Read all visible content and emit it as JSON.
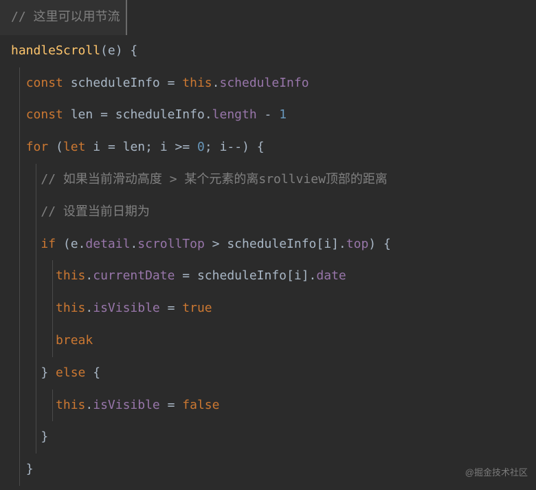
{
  "code": {
    "lines": [
      {
        "indent": 0,
        "tokens": [
          {
            "t": "// 这里可以用节流",
            "c": "comment"
          }
        ],
        "highlight": true
      },
      {
        "indent": 0,
        "tokens": [
          {
            "t": "handleScroll",
            "c": "method"
          },
          {
            "t": "(",
            "c": "punct"
          },
          {
            "t": "e",
            "c": "param"
          },
          {
            "t": ") {",
            "c": "punct"
          }
        ]
      },
      {
        "indent": 1,
        "tokens": [
          {
            "t": "const ",
            "c": "keyword"
          },
          {
            "t": "scheduleInfo ",
            "c": "var"
          },
          {
            "t": "= ",
            "c": "op"
          },
          {
            "t": "this",
            "c": "this"
          },
          {
            "t": ".",
            "c": "punct"
          },
          {
            "t": "scheduleInfo",
            "c": "prop"
          }
        ]
      },
      {
        "indent": 1,
        "tokens": [
          {
            "t": "const ",
            "c": "keyword"
          },
          {
            "t": "len ",
            "c": "var"
          },
          {
            "t": "= ",
            "c": "op"
          },
          {
            "t": "scheduleInfo",
            "c": "var"
          },
          {
            "t": ".",
            "c": "punct"
          },
          {
            "t": "length ",
            "c": "prop"
          },
          {
            "t": "- ",
            "c": "op"
          },
          {
            "t": "1",
            "c": "num"
          }
        ]
      },
      {
        "indent": 1,
        "tokens": [
          {
            "t": "for ",
            "c": "keyword"
          },
          {
            "t": "(",
            "c": "punct"
          },
          {
            "t": "let ",
            "c": "keyword"
          },
          {
            "t": "i ",
            "c": "var"
          },
          {
            "t": "= ",
            "c": "op"
          },
          {
            "t": "len",
            "c": "var"
          },
          {
            "t": "; ",
            "c": "punct"
          },
          {
            "t": "i ",
            "c": "var"
          },
          {
            "t": ">= ",
            "c": "op"
          },
          {
            "t": "0",
            "c": "num"
          },
          {
            "t": "; ",
            "c": "punct"
          },
          {
            "t": "i",
            "c": "var"
          },
          {
            "t": "--",
            "c": "op"
          },
          {
            "t": ") {",
            "c": "punct"
          }
        ]
      },
      {
        "indent": 2,
        "tokens": [
          {
            "t": "// 如果当前滑动高度 > 某个元素的离srollview顶部的距离",
            "c": "comment"
          }
        ]
      },
      {
        "indent": 2,
        "tokens": [
          {
            "t": "// 设置当前日期为",
            "c": "comment"
          }
        ]
      },
      {
        "indent": 2,
        "tokens": [
          {
            "t": "if ",
            "c": "keyword"
          },
          {
            "t": "(",
            "c": "punct"
          },
          {
            "t": "e",
            "c": "var"
          },
          {
            "t": ".",
            "c": "punct"
          },
          {
            "t": "detail",
            "c": "prop"
          },
          {
            "t": ".",
            "c": "punct"
          },
          {
            "t": "scrollTop ",
            "c": "prop"
          },
          {
            "t": "> ",
            "c": "op"
          },
          {
            "t": "scheduleInfo",
            "c": "var"
          },
          {
            "t": "[",
            "c": "punct"
          },
          {
            "t": "i",
            "c": "var"
          },
          {
            "t": "]",
            "c": "punct"
          },
          {
            "t": ".",
            "c": "punct"
          },
          {
            "t": "top",
            "c": "prop"
          },
          {
            "t": ") {",
            "c": "punct"
          }
        ]
      },
      {
        "indent": 3,
        "tokens": [
          {
            "t": "this",
            "c": "this"
          },
          {
            "t": ".",
            "c": "punct"
          },
          {
            "t": "currentDate ",
            "c": "prop"
          },
          {
            "t": "= ",
            "c": "op"
          },
          {
            "t": "scheduleInfo",
            "c": "var"
          },
          {
            "t": "[",
            "c": "punct"
          },
          {
            "t": "i",
            "c": "var"
          },
          {
            "t": "]",
            "c": "punct"
          },
          {
            "t": ".",
            "c": "punct"
          },
          {
            "t": "date",
            "c": "prop"
          }
        ]
      },
      {
        "indent": 3,
        "tokens": [
          {
            "t": "this",
            "c": "this"
          },
          {
            "t": ".",
            "c": "punct"
          },
          {
            "t": "isVisible ",
            "c": "prop"
          },
          {
            "t": "= ",
            "c": "op"
          },
          {
            "t": "true",
            "c": "bool"
          }
        ]
      },
      {
        "indent": 3,
        "tokens": [
          {
            "t": "break",
            "c": "keyword"
          }
        ]
      },
      {
        "indent": 2,
        "tokens": [
          {
            "t": "} ",
            "c": "punct"
          },
          {
            "t": "else ",
            "c": "keyword"
          },
          {
            "t": "{",
            "c": "punct"
          }
        ]
      },
      {
        "indent": 3,
        "tokens": [
          {
            "t": "this",
            "c": "this"
          },
          {
            "t": ".",
            "c": "punct"
          },
          {
            "t": "isVisible ",
            "c": "prop"
          },
          {
            "t": "= ",
            "c": "op"
          },
          {
            "t": "false",
            "c": "bool"
          }
        ]
      },
      {
        "indent": 2,
        "tokens": [
          {
            "t": "}",
            "c": "punct"
          }
        ]
      },
      {
        "indent": 1,
        "tokens": [
          {
            "t": "}",
            "c": "punct"
          }
        ]
      }
    ]
  },
  "watermark": "@掘金技术社区"
}
